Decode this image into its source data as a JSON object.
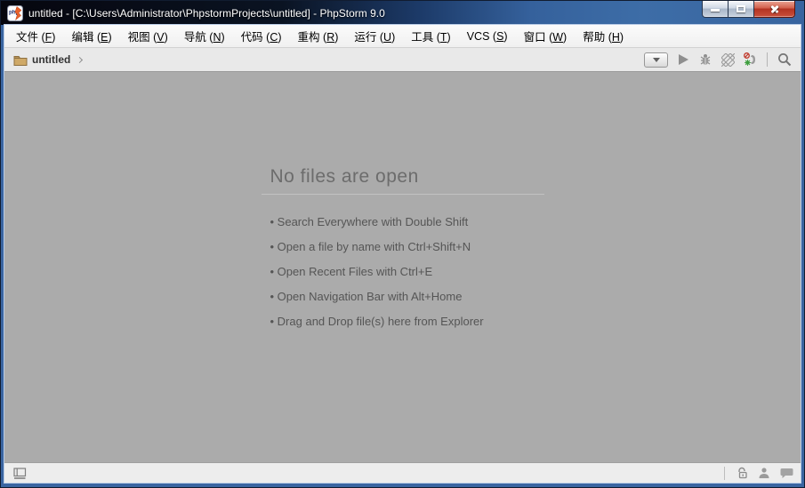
{
  "window": {
    "title": "untitled - [C:\\Users\\Administrator\\PhpstormProjects\\untitled] - PhpStorm 9.0",
    "app_name": "PhpStorm 9.0"
  },
  "menu": {
    "items": [
      {
        "label": "文件",
        "mnemonic": "F"
      },
      {
        "label": "编辑",
        "mnemonic": "E"
      },
      {
        "label": "视图",
        "mnemonic": "V"
      },
      {
        "label": "导航",
        "mnemonic": "N"
      },
      {
        "label": "代码",
        "mnemonic": "C"
      },
      {
        "label": "重构",
        "mnemonic": "R"
      },
      {
        "label": "运行",
        "mnemonic": "U"
      },
      {
        "label": "工具",
        "mnemonic": "T"
      },
      {
        "label": "VCS",
        "mnemonic": "S"
      },
      {
        "label": "窗口",
        "mnemonic": "W"
      },
      {
        "label": "帮助",
        "mnemonic": "H"
      }
    ]
  },
  "navbar": {
    "project_name": "untitled",
    "icons": [
      "folder-icon",
      "chevron-right-icon"
    ]
  },
  "toolbar": {
    "icons": [
      "run-config-dropdown",
      "run-icon",
      "debug-bug-icon",
      "coverage-icon",
      "attach-debugger-icon",
      "search-icon"
    ]
  },
  "empty_state": {
    "title": "No files are open",
    "tips": [
      "Search Everywhere with Double Shift",
      "Open a file by name with Ctrl+Shift+N",
      "Open Recent Files with Ctrl+E",
      "Open Navigation Bar with Alt+Home",
      "Drag and Drop file(s) here from Explorer"
    ]
  },
  "statusbar": {
    "icons": [
      "toggle-toolwindows-icon",
      "unlock-icon",
      "inspections-profile-icon",
      "event-log-icon"
    ]
  },
  "colors": {
    "titlebar_blue": "#3d6da7",
    "frame_blue": "#3a65a1",
    "content_gray": "#ababab",
    "menubar_bg": "#f7f7f7",
    "navbar_bg": "#e9e9e9",
    "close_button_red": "#c4513f",
    "folder_tan": "#c7a263",
    "empty_title_gray": "#6c6c6c",
    "tip_text_gray": "#555555"
  }
}
